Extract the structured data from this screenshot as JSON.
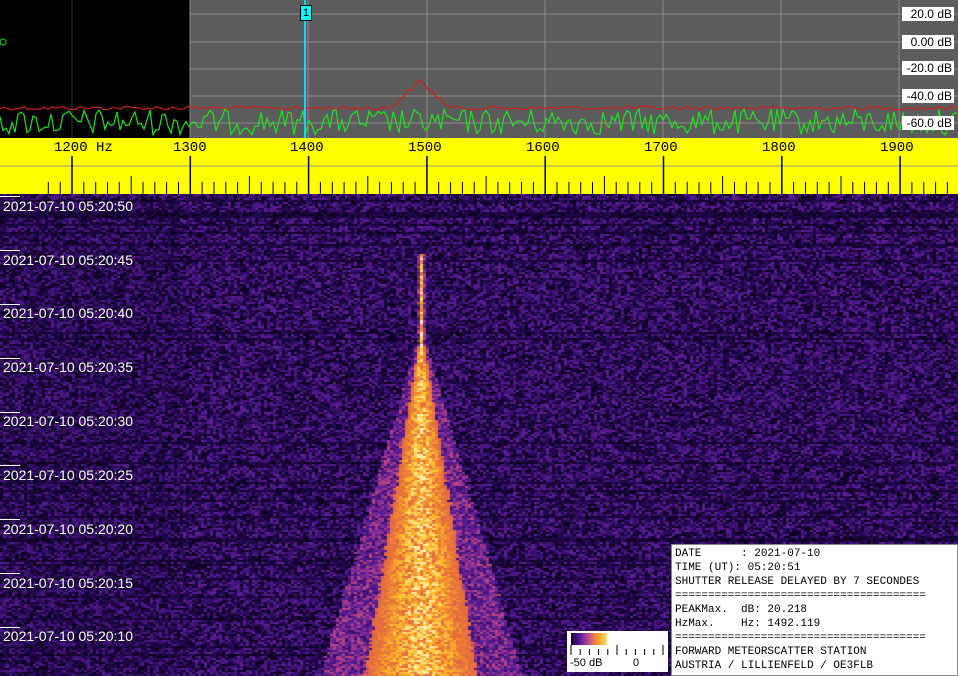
{
  "spectrum": {
    "db_labels": [
      "20.0 dB",
      "0.00 dB",
      "-20.0 dB",
      "-40.0 dB",
      "-60.0 dB"
    ],
    "marker_label": "1",
    "colors": {
      "peak_trace": "#cc2020",
      "live_trace": "#20e020",
      "marker": "#00e0e0",
      "grid_bg": "#5c5c5c",
      "left_bg": "#000000"
    }
  },
  "ruler": {
    "labels": [
      "1200 Hz",
      "1300",
      "1400",
      "1500",
      "1600",
      "1700",
      "1800",
      "1900"
    ],
    "color": "#ffff00"
  },
  "waterfall": {
    "timestamps": [
      "2021-07-10 05:20:50",
      "2021-07-10 05:20:45",
      "2021-07-10 05:20:40",
      "2021-07-10 05:20:35",
      "2021-07-10 05:20:30",
      "2021-07-10 05:20:25",
      "2021-07-10 05:20:20",
      "2021-07-10 05:20:15",
      "2021-07-10 05:20:10"
    ]
  },
  "legend": {
    "min_label": "-50 dB",
    "max_label": "0"
  },
  "info": {
    "lines": [
      "DATE      : 2021-07-10",
      "TIME (UT): 05:20:51",
      "SHUTTER RELEASE DELAYED BY 7 SECONDES",
      "======================================",
      "PEAKMax.  dB: 20.218",
      "HzMax.    Hz: 1492.119",
      "======================================",
      "FORWARD METEORSCATTER STATION",
      "AUSTRIA / LILLIENFELD / OE3FLB"
    ]
  }
}
